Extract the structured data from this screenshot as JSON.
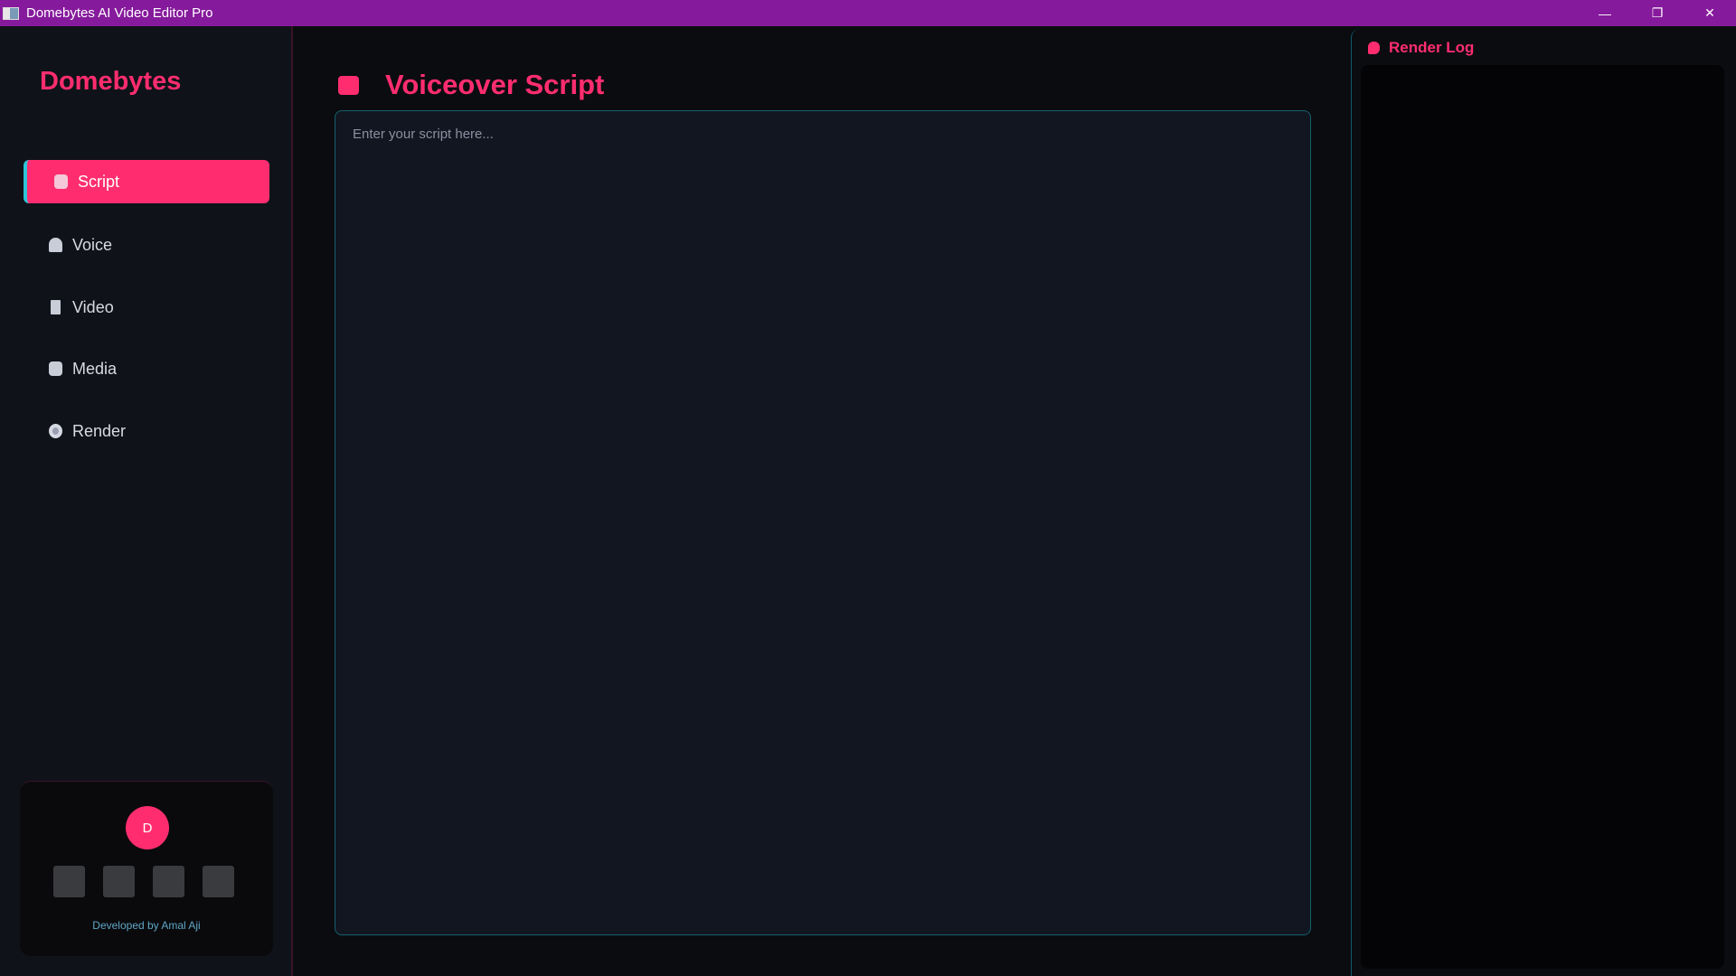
{
  "window": {
    "title": "Domebytes AI Video Editor Pro",
    "controls": {
      "minimize": "—",
      "restore": "❐",
      "close": "✕"
    }
  },
  "sidebar": {
    "brand": "Domebytes",
    "items": [
      {
        "label": "Script",
        "icon": "script-icon",
        "active": true
      },
      {
        "label": "Voice",
        "icon": "bell-icon",
        "active": false
      },
      {
        "label": "Video",
        "icon": "video-icon",
        "active": false
      },
      {
        "label": "Media",
        "icon": "media-icon",
        "active": false
      },
      {
        "label": "Render",
        "icon": "render-icon",
        "active": false
      }
    ],
    "profile": {
      "avatar_letter": "D",
      "credit": "Developed by Amal Aji"
    }
  },
  "main": {
    "title": "Voiceover Script",
    "script_placeholder": "Enter your script here...",
    "script_value": ""
  },
  "render_log": {
    "title": "Render Log",
    "entries": []
  },
  "colors": {
    "accent": "#ff2d6f",
    "titlebar": "#861a9c",
    "border_teal": "#16606e"
  }
}
